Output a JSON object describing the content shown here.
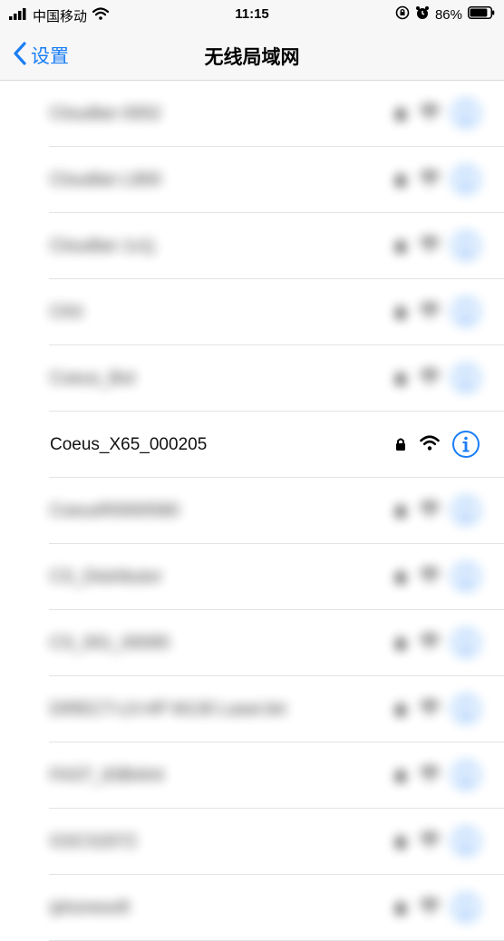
{
  "status_bar": {
    "carrier": "中国移动",
    "time": "11:15",
    "battery_percent": "86%",
    "battery_level": 0.86
  },
  "nav": {
    "back_label": "设置",
    "title": "无线局域网"
  },
  "networks": [
    {
      "ssid": "Cloudlan 0002",
      "blurred": true
    },
    {
      "ssid": "Cloudlan L800",
      "blurred": true
    },
    {
      "ssid": "Cloudlan 1x1j",
      "blurred": true
    },
    {
      "ssid": "CKit",
      "blurred": true
    },
    {
      "ssid": "Coeus_Bot",
      "blurred": true
    },
    {
      "ssid": "Coeus_X65_000205",
      "blurred": false
    },
    {
      "ssid": "CoeusR0000580",
      "blurred": true
    },
    {
      "ssid": "CS_Distributor",
      "blurred": true
    },
    {
      "ssid": "CS_001_00095",
      "blurred": true
    },
    {
      "ssid": "DIRECT-L0-HP M130 LaserJet",
      "blurred": true
    },
    {
      "ssid": "FAST_83B4A4",
      "blurred": true
    },
    {
      "ssid": "GSCS2072",
      "blurred": true
    },
    {
      "ssid": "iphonesoft",
      "blurred": true
    }
  ],
  "colors": {
    "accent": "#1a7ef5",
    "nav_background": "#f7f7f7",
    "separator": "#e3e3e3"
  },
  "icons": {
    "lock": "lock-icon",
    "wifi": "wifi-icon",
    "info": "info-icon",
    "back": "chevron-left-icon"
  }
}
